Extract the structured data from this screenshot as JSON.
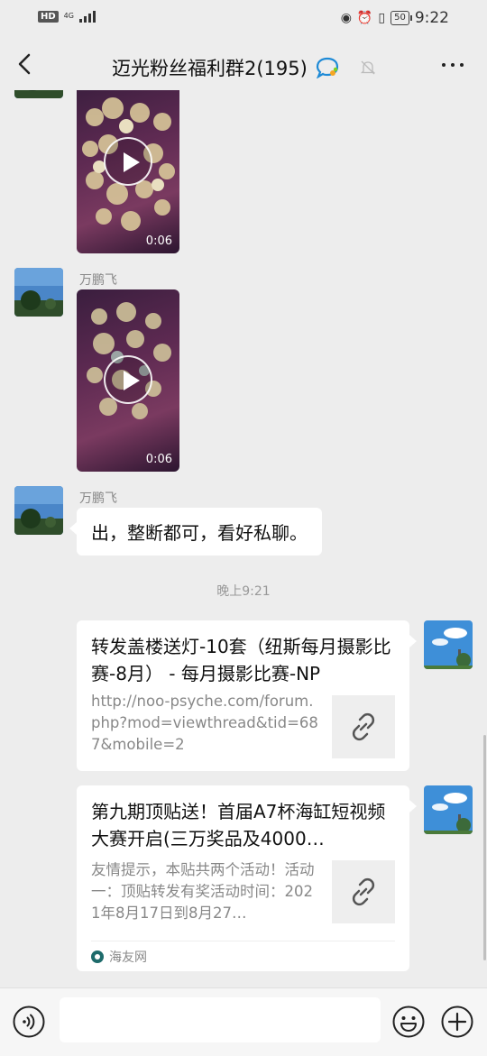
{
  "status_bar": {
    "hd_label": "HD",
    "network_label": "4G",
    "battery_level": "50",
    "time": "9:22"
  },
  "header": {
    "title": "迈光粉丝福利群2(195)",
    "icons": [
      "back-icon",
      "group-chat-icon",
      "mute-bell-icon",
      "more-icon"
    ]
  },
  "messages": [
    {
      "type": "video",
      "sender": "",
      "duration": "0:06"
    },
    {
      "type": "video",
      "sender": "万鹏飞",
      "duration": "0:06"
    },
    {
      "type": "text",
      "sender": "万鹏飞",
      "text": "出，整断都可，看好私聊。"
    }
  ],
  "timestamp": "晚上9:21",
  "link_cards": [
    {
      "title": "转发盖楼送灯-10套（纽斯每月摄影比赛-8月） - 每月摄影比赛-NP",
      "description": "http://noo-psyche.com/forum.php?mod=viewthread&tid=687&mobile=2",
      "thumbnail_icon": "link-icon",
      "source": ""
    },
    {
      "title": "第九期顶贴送！首届A7杯海缸短视频大赛开启(三万奖品及4000…",
      "description": "友情提示，本贴共两个活动！活动一：顶贴转发有奖活动时间：2021年8月17日到8月27…",
      "thumbnail_icon": "link-icon",
      "source": "海友网"
    }
  ],
  "input_bar": {
    "placeholder": "",
    "icons": [
      "voice-icon",
      "emoji-icon",
      "plus-icon"
    ]
  },
  "colors": {
    "background": "#ededed",
    "bubble": "#ffffff",
    "input_bar": "#f6f6f6",
    "muted_text": "#888888"
  }
}
